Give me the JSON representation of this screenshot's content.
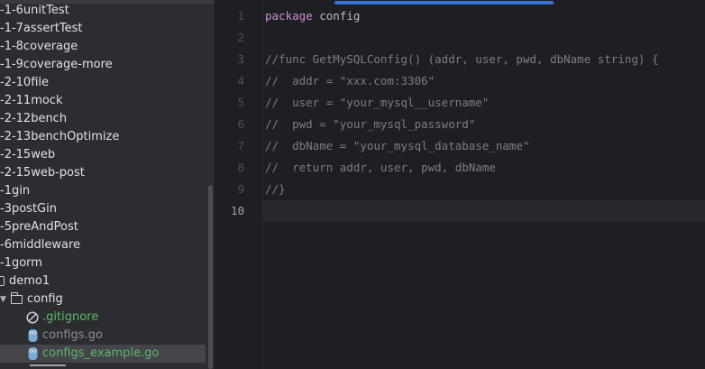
{
  "project_tree": {
    "items": [
      {
        "label": "-1-6unitTest"
      },
      {
        "label": "-1-7assertTest"
      },
      {
        "label": "-1-8coverage"
      },
      {
        "label": "-1-9coverage-more"
      },
      {
        "label": "-2-10file"
      },
      {
        "label": "-2-11mock"
      },
      {
        "label": "-2-12bench"
      },
      {
        "label": "-2-13benchOptimize"
      },
      {
        "label": "-2-15web"
      },
      {
        "label": "-2-15web-post"
      },
      {
        "label": "-1gin"
      },
      {
        "label": "-3postGin"
      },
      {
        "label": "-5preAndPost"
      },
      {
        "label": "-6middleware"
      },
      {
        "label": "-1gorm"
      },
      {
        "label": "demo1"
      },
      {
        "label": "config"
      },
      {
        "label": ".gitignore"
      },
      {
        "label": "configs.go"
      },
      {
        "label": "configs_example.go"
      }
    ],
    "colors": {
      "ignored": "#5fb865",
      "excluded": "#8b8e94",
      "added": "#5fb865"
    }
  },
  "editor": {
    "line_numbers": [
      "1",
      "2",
      "3",
      "4",
      "5",
      "6",
      "7",
      "8",
      "9",
      "10"
    ],
    "current_line": "10",
    "lines": [
      {
        "kw": "package",
        "text": " config",
        "comment": ""
      },
      {
        "kw": "",
        "text": "",
        "comment": ""
      },
      {
        "kw": "",
        "text": "",
        "comment": "//func GetMySQLConfig() (addr, user, pwd, dbName string) {"
      },
      {
        "kw": "",
        "text": "",
        "comment": "//  addr = \"xxx.com:3306\""
      },
      {
        "kw": "",
        "text": "",
        "comment": "//  user = \"your_mysql__username\""
      },
      {
        "kw": "",
        "text": "",
        "comment": "//  pwd = \"your_mysql_password\""
      },
      {
        "kw": "",
        "text": "",
        "comment": "//  dbName = \"your_mysql_database_name\""
      },
      {
        "kw": "",
        "text": "",
        "comment": "//  return addr, user, pwd, dbName"
      },
      {
        "kw": "",
        "text": "",
        "comment": "//}"
      },
      {
        "kw": "",
        "text": "",
        "comment": ""
      }
    ],
    "colors": {
      "keyword": "#cf8ed6",
      "comment": "#7a7e85",
      "tab_accent": "#3874d8"
    }
  }
}
